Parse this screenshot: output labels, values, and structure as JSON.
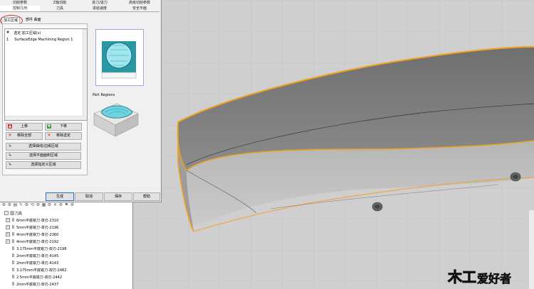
{
  "dialog": {
    "tabs_row1": [
      "切削参数",
      "Z轴切削",
      "进刀/退刀",
      "高级切削参数"
    ],
    "tabs_row2": [
      "控制几何",
      "刀具",
      "进给速度",
      "安全平面"
    ],
    "subtabs": [
      "加工区域",
      "部件 曲面"
    ],
    "list": {
      "headers": [
        "#",
        "选定 加工区域(s)"
      ],
      "rows": [
        {
          "index": "1",
          "name": "SurfaceEdge Machining Region 1"
        }
      ]
    },
    "buttons": {
      "up": "上移",
      "down": "下移",
      "remove_all": "移除全部",
      "remove_selected": "移除选定",
      "select_curves": "选择曲线/边缘区域",
      "select_plane": "选择平面面积区域",
      "select_custom": "选择指定义区域"
    },
    "preview_label": "Part Regions",
    "footer": {
      "generate": "生成",
      "cancel": "取消",
      "save": "保存",
      "help": "帮助"
    }
  },
  "browser": {
    "root": "刀具",
    "items": [
      "6mm平底铣刀-单刃-2310",
      "5mm平底铣刀-单刃-2196",
      "4mm平底铣刀-单刃-2360",
      "4mm平底铣刀-单刃-2192",
      "3.175mm平底铣刀-双刃-2198",
      "2mm平底铣刀-单刃-4145",
      "2mm平底铣刀-单刃-4143",
      "3.175mm平底铣刀-双刃-2482",
      "2.5mm平底铣刀-双刃-2442",
      "2mm平底铣刀-双刃-2437"
    ]
  },
  "watermark": {
    "part1": "木工",
    "part2": "爱好者"
  },
  "colors": {
    "edge": "#f0a020",
    "accent": "#2a6fd0",
    "remove": "#c0281e"
  }
}
